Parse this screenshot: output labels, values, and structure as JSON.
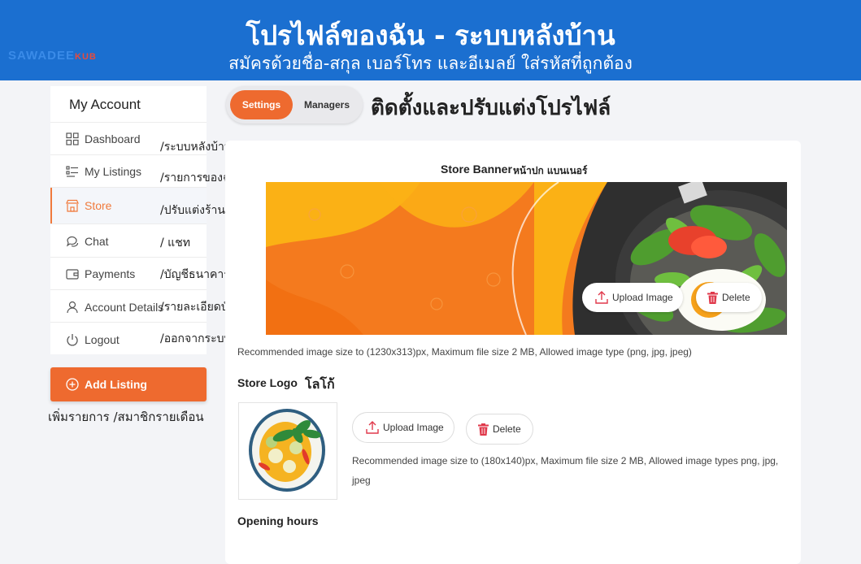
{
  "header": {
    "title": "โปรไฟล์ของฉัน - ระบบหลังบ้าน",
    "subtitle": "สมัครด้วยชื่อ-สกุล เบอร์โทร และอีเมลย์ ใส่รหัสที่ถูกต้อง",
    "logo_text": "SAWADEE",
    "logo_suffix": "KUB"
  },
  "sidebar": {
    "title": "My Account",
    "items": [
      {
        "label": "Dashboard",
        "note": "/ระบบหลังบ้าน",
        "icon": "dashboard-icon"
      },
      {
        "label": "My Listings",
        "note": "/รายการของฉัน",
        "icon": "list-icon"
      },
      {
        "label": "Store",
        "note": "/ปรับแต่งร้านค้า",
        "icon": "store-icon",
        "active": true
      },
      {
        "label": "Chat",
        "note": "/ แชท",
        "icon": "chat-icon"
      },
      {
        "label": "Payments",
        "note": "/บัญชีธนาคาร",
        "icon": "wallet-icon"
      },
      {
        "label": "Account Details",
        "note": "/รายละเอียดบัญชี",
        "icon": "user-icon"
      },
      {
        "label": "Logout",
        "note": "/ออกจากระบบ",
        "icon": "power-icon"
      }
    ],
    "add_listing": "Add Listing",
    "add_listing_note": "เพิ่มรายการ /สมาชิกรายเดือน"
  },
  "tabs": {
    "settings": "Settings",
    "managers": "Managers"
  },
  "settings_title": "ติดตั้งและปรับแต่งโปรไฟล์",
  "banner": {
    "label": "Store Banner",
    "label_th": "หน้าปก แบนเนอร์",
    "upload": "Upload Image",
    "delete": "Delete",
    "note": "Recommended image size to (1230x313)px, Maximum file size 2 MB, Allowed image type (png, jpg, jpeg)"
  },
  "logo": {
    "label": "Store Logo",
    "label_th": "โลโก้",
    "upload": "Upload Image",
    "delete": "Delete",
    "note_line1": "Recommended image size to (180x140)px, Maximum file size 2 MB, Allowed image types png, jpg,",
    "note_line2": "jpeg"
  },
  "opening_hours": "Opening hours",
  "colors": {
    "header": "#1b6fd0",
    "accent": "#ee6a2f",
    "delete": "#e0394b"
  }
}
